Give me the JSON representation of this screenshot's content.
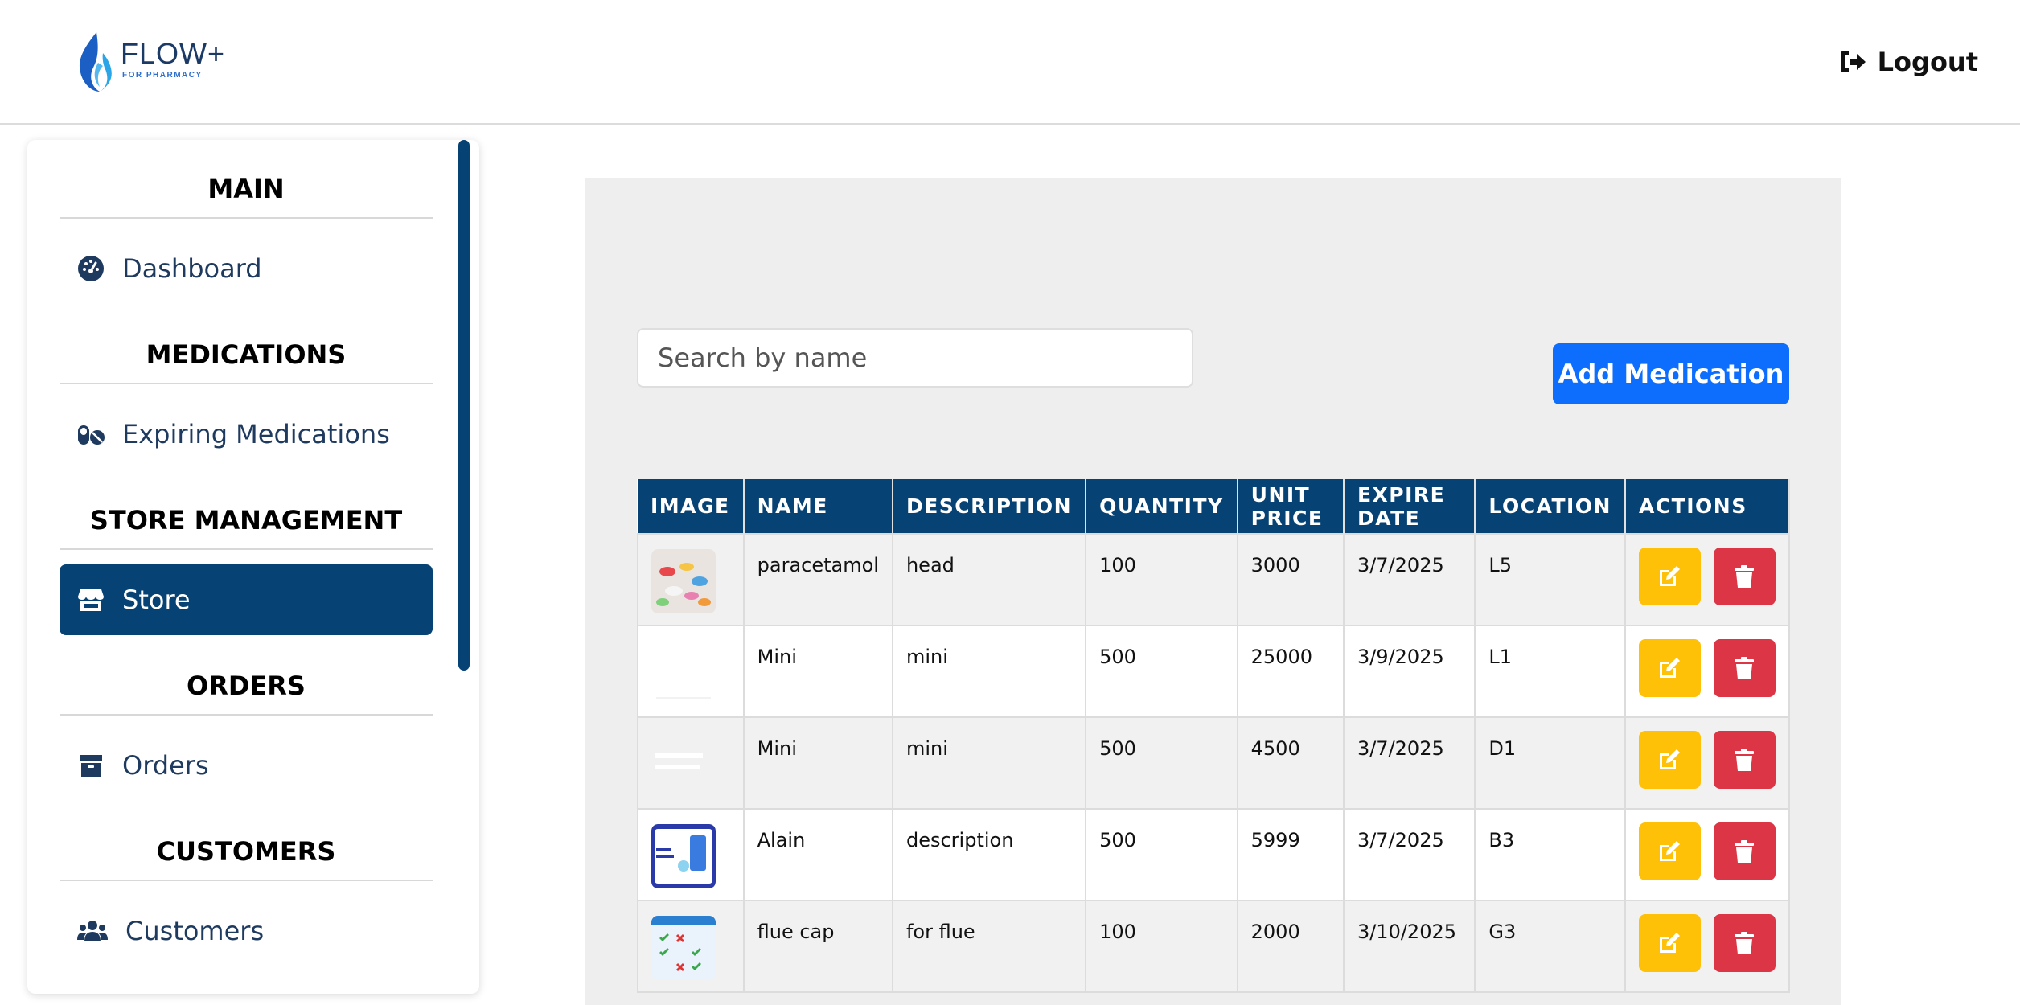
{
  "brand": {
    "title": "FLOW+",
    "subtitle": "FOR PHARMACY",
    "logo_colors": [
      "#1b5fc4",
      "#2aa6e8"
    ]
  },
  "header": {
    "logout_label": "Logout",
    "logout_icon": "sign-out-icon"
  },
  "sidebar": {
    "sections": [
      {
        "heading": "MAIN",
        "item": {
          "label": "Dashboard",
          "icon": "gauge-icon",
          "active": false
        }
      },
      {
        "heading": "MEDICATIONS",
        "item": {
          "label": "Expiring Medications",
          "icon": "pills-icon",
          "active": false
        }
      },
      {
        "heading": "STORE MANAGEMENT",
        "item": {
          "label": "Store",
          "icon": "store-icon",
          "active": true
        }
      },
      {
        "heading": "ORDERS",
        "item": {
          "label": "Orders",
          "icon": "box-icon",
          "active": false
        }
      },
      {
        "heading": "CUSTOMERS",
        "item": {
          "label": "Customers",
          "icon": "users-icon",
          "active": false
        }
      }
    ]
  },
  "main": {
    "search_placeholder": "Search by name",
    "add_button_label": "Add Medication",
    "table": {
      "headers": [
        "IMAGE",
        "NAME",
        "DESCRIPTION",
        "QUANTITY",
        "UNIT PRICE",
        "EXPIRE DATE",
        "LOCATION",
        "ACTIONS"
      ],
      "rows": [
        {
          "name": "paracetamol",
          "description": "head",
          "quantity": "100",
          "unit_price": "3000",
          "expire_date": "3/7/2025",
          "location": "L5",
          "image": "pills-photo"
        },
        {
          "name": "Mini",
          "description": "mini",
          "quantity": "500",
          "unit_price": "25000",
          "expire_date": "3/9/2025",
          "location": "L1",
          "image": "blank-photo"
        },
        {
          "name": "Mini",
          "description": "mini",
          "quantity": "500",
          "unit_price": "4500",
          "expire_date": "3/7/2025",
          "location": "D1",
          "image": "faded-photo"
        },
        {
          "name": "Alain",
          "description": "description",
          "quantity": "500",
          "unit_price": "5999",
          "expire_date": "3/7/2025",
          "location": "B3",
          "image": "app-banner-photo"
        },
        {
          "name": "flue cap",
          "description": "for flue",
          "quantity": "100",
          "unit_price": "2000",
          "expire_date": "3/10/2025",
          "location": "G3",
          "image": "checklist-photo"
        }
      ]
    }
  },
  "colors": {
    "primary_navy": "#064273",
    "add_button": "#0d6efd",
    "edit_button": "#ffc107",
    "delete_button": "#dc3545",
    "panel_bg": "#eeeeee"
  }
}
